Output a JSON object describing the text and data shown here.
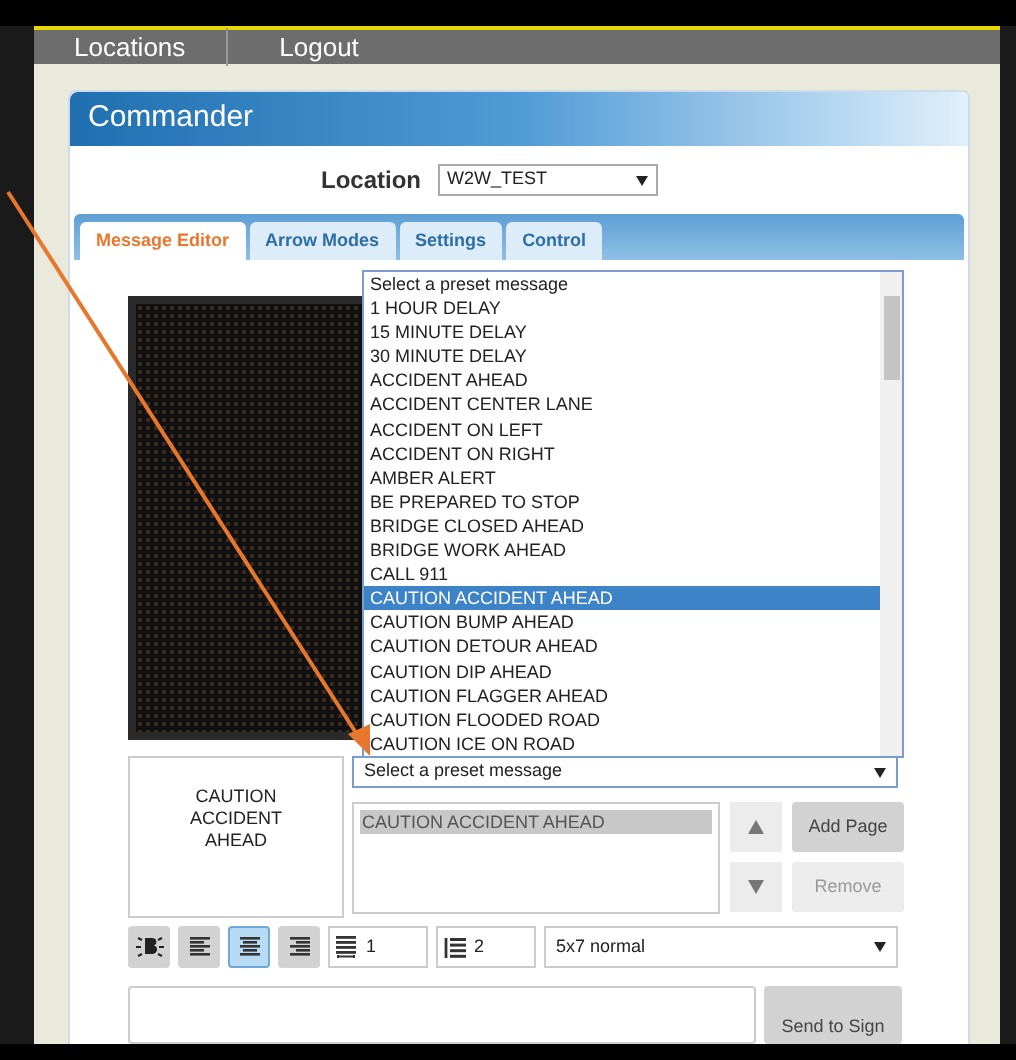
{
  "nav": [
    {
      "label": "Locations"
    },
    {
      "label": "Logout"
    }
  ],
  "title": "Commander",
  "location": {
    "label": "Location",
    "value": "W2W_TEST"
  },
  "tabs": [
    {
      "label": "Message Editor",
      "selected": true
    },
    {
      "label": "Arrow Modes",
      "selected": false
    },
    {
      "label": "Settings",
      "selected": false
    },
    {
      "label": "Control",
      "selected": false
    }
  ],
  "preset_list": {
    "options": [
      {
        "label": "Select a preset message",
        "selected": false
      },
      {
        "label": "1 HOUR DELAY",
        "selected": false
      },
      {
        "label": "15 MINUTE DELAY",
        "selected": false
      },
      {
        "label": "30 MINUTE DELAY",
        "selected": false
      },
      {
        "label": "ACCIDENT AHEAD",
        "selected": false
      },
      {
        "label": "ACCIDENT CENTER LANE",
        "selected": false
      },
      {
        "label": "ACCIDENT ON LEFT",
        "selected": false
      },
      {
        "label": "ACCIDENT ON RIGHT",
        "selected": false
      },
      {
        "label": "AMBER ALERT",
        "selected": false
      },
      {
        "label": "BE PREPARED TO STOP",
        "selected": false
      },
      {
        "label": "BRIDGE CLOSED AHEAD",
        "selected": false
      },
      {
        "label": "BRIDGE WORK AHEAD",
        "selected": false
      },
      {
        "label": "CALL 911",
        "selected": false
      },
      {
        "label": "CAUTION ACCIDENT AHEAD",
        "selected": true
      },
      {
        "label": "CAUTION BUMP AHEAD",
        "selected": false
      },
      {
        "label": "CAUTION DETOUR AHEAD",
        "selected": false
      },
      {
        "label": "CAUTION DIP AHEAD",
        "selected": false
      },
      {
        "label": "CAUTION FLAGGER AHEAD",
        "selected": false
      },
      {
        "label": "CAUTION FLOODED ROAD",
        "selected": false
      },
      {
        "label": "CAUTION ICE ON ROAD",
        "selected": false
      }
    ]
  },
  "preset_select": {
    "value": "Select a preset message"
  },
  "preview": {
    "text": "CAUTION ACCIDENT AHEAD"
  },
  "pages": [
    {
      "label": "CAUTION ACCIDENT AHEAD",
      "selected": true
    }
  ],
  "page_buttons": [
    {
      "label": "Add Page",
      "disabled": false
    },
    {
      "label": "Remove",
      "disabled": true
    }
  ],
  "format": {
    "bold": false,
    "aligns": [
      {
        "kind": "left",
        "selected": false
      },
      {
        "kind": "center",
        "selected": true
      },
      {
        "kind": "right",
        "selected": false
      }
    ],
    "line_spacing": "1",
    "lines": "2",
    "font": "5x7 normal"
  },
  "send_button": {
    "label": "Send to Sign"
  }
}
